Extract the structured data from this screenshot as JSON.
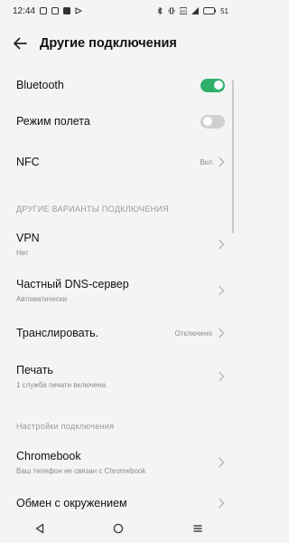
{
  "status_bar": {
    "time": "12:44",
    "battery_label": "51",
    "icons": [
      "notification-icon",
      "notification-icon",
      "media-icon",
      "send-icon",
      "bluetooth-icon",
      "vibrate-icon",
      "data-icon",
      "signal-icon",
      "battery-icon"
    ]
  },
  "header": {
    "title": "Другие подключения"
  },
  "items": {
    "bluetooth": {
      "label": "Bluetooth",
      "toggle": "on"
    },
    "airplane": {
      "label": "Режим полета",
      "toggle": "off"
    },
    "nfc": {
      "label": "NFC",
      "value": "Вкл"
    },
    "vpn": {
      "label": "VPN",
      "sub": "Нет"
    },
    "dns": {
      "label": "Частный DNS-сервер",
      "sub": "Автоматически"
    },
    "cast": {
      "label": "Транслировать.",
      "value": "Отключено"
    },
    "print": {
      "label": "Печать",
      "sub": "1 служба печати включена"
    },
    "chromebook": {
      "label": "Chromebook",
      "sub": "Ваш телефон не связан с Chromebook"
    },
    "share": {
      "label": "Обмен с окружением"
    }
  },
  "sections": {
    "other_options": "ДРУГИЕ ВАРИАНТЫ ПОДКЛЮЧЕНИЯ",
    "connection_settings": "Настройки подключения"
  },
  "colors": {
    "accent": "#2fb06a",
    "background": "#f4f4f4",
    "secondary_text": "#8a8a8a"
  },
  "nav_icons": [
    "back-triangle-icon",
    "home-circle-icon",
    "menu-lines-icon"
  ]
}
